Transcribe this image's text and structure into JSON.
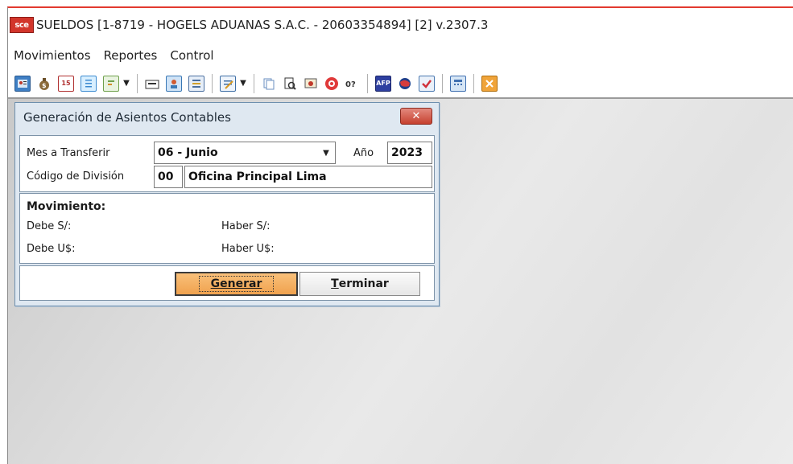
{
  "window": {
    "logo_text": "sce",
    "title": "SUELDOS [1-8719 - HOGELS ADUANAS S.A.C. - 20603354894] [2] v.2307.3"
  },
  "menu": [
    "Movimientos",
    "Reportes",
    "Control"
  ],
  "toolbar": {
    "icons": [
      "contact-card-icon",
      "money-bag-icon",
      "calendar-icon",
      "document-list-icon",
      "form-icon",
      "folder-icon",
      "person-card-icon",
      "columns-icon",
      "edit-form-icon",
      "copy-icon",
      "print-preview-icon",
      "certificate-icon",
      "stop-icon",
      "help-text-icon",
      "afp-icon",
      "globe-icon",
      "check-icon",
      "calculator-icon",
      "exit-icon"
    ],
    "afp_label": "AFP",
    "calendar_label": "15"
  },
  "dialog": {
    "title": "Generación de Asientos Contables",
    "close_symbol": "✕",
    "mes_label": "Mes a Transferir",
    "mes_value": "06 - Junio",
    "anio_label": "Año",
    "anio_value": "2023",
    "division_label": "Código de División",
    "division_code": "00",
    "division_name": "Oficina Principal Lima",
    "movimiento_title": "Movimiento:",
    "debe_soles_label": "Debe S/:",
    "haber_soles_label": "Haber S/:",
    "debe_dolares_label": "Debe U$:",
    "haber_dolares_label": "Haber U$:",
    "generar_label": "Generar",
    "terminar_first": "T",
    "terminar_rest": "erminar"
  },
  "colors": {
    "title_accent": "#e23a2f",
    "dialog_bg": "#dfe8f1",
    "primary_button": "#f0a24e"
  }
}
